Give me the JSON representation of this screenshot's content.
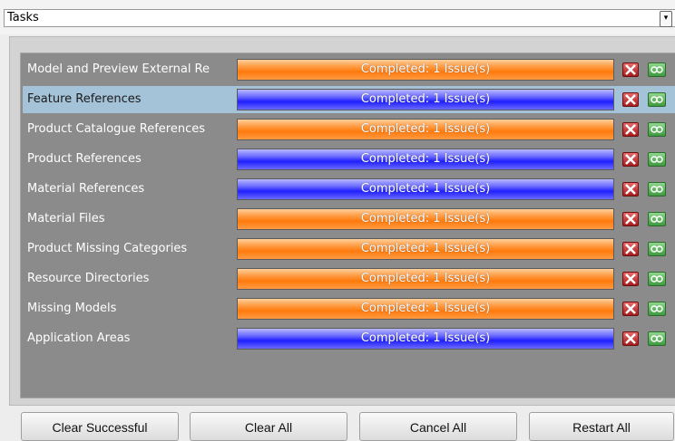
{
  "header": {
    "title": "Tasks",
    "dropdown_icon": "chevron-down-icon"
  },
  "tasks": [
    {
      "name": "Model and Preview External Re",
      "status": "Completed: 1 Issue(s)",
      "color": "#ff8a20",
      "selected": false
    },
    {
      "name": "Feature References",
      "status": "Completed: 1 Issue(s)",
      "color": "#3a3aff",
      "selected": true
    },
    {
      "name": "Product Catalogue References",
      "status": "Completed: 1 Issue(s)",
      "color": "#ff8a20",
      "selected": false
    },
    {
      "name": "Product References",
      "status": "Completed: 1 Issue(s)",
      "color": "#3a3aff",
      "selected": false
    },
    {
      "name": "Material References",
      "status": "Completed: 1 Issue(s)",
      "color": "#3a3aff",
      "selected": false
    },
    {
      "name": "Material Files",
      "status": "Completed: 1 Issue(s)",
      "color": "#ff8a20",
      "selected": false
    },
    {
      "name": "Product Missing Categories",
      "status": "Completed: 1 Issue(s)",
      "color": "#ff8a20",
      "selected": false
    },
    {
      "name": "Resource Directories",
      "status": "Completed: 1 Issue(s)",
      "color": "#ff8a20",
      "selected": false
    },
    {
      "name": "Missing Models",
      "status": "Completed: 1 Issue(s)",
      "color": "#ff8a20",
      "selected": false
    },
    {
      "name": "Application Areas",
      "status": "Completed: 1 Issue(s)",
      "color": "#3a3aff",
      "selected": false
    }
  ],
  "footer": {
    "clear_successful": "Clear Successful",
    "clear_all": "Clear All",
    "cancel_all": "Cancel All",
    "restart_all": "Restart All"
  }
}
